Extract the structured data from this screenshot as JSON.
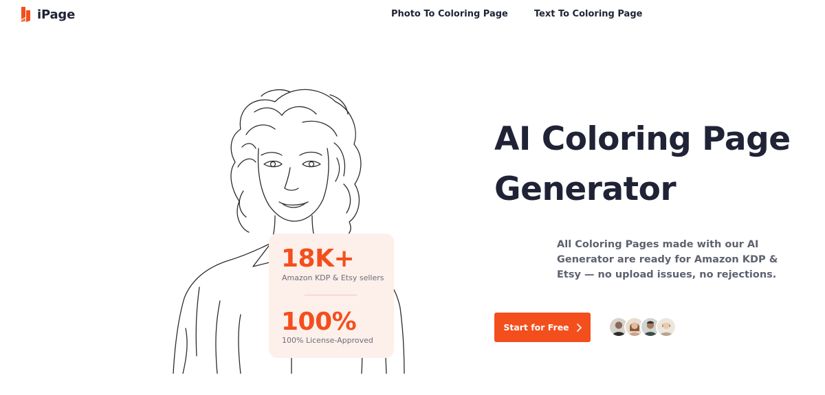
{
  "brand": {
    "name": "iPage",
    "accent_color": "#f34f1d",
    "logo_icon": "bookmark-ribbon-icon"
  },
  "nav": {
    "items": [
      {
        "label": "Photo To Coloring Page"
      },
      {
        "label": "Text To Coloring Page"
      }
    ]
  },
  "hero": {
    "title": "AI Coloring Page Generator",
    "subtitle": "All Coloring Pages made with our AI Generator are ready for Amazon KDP & Etsy — no upload issues, no rejections.",
    "cta_label": "Start for Free",
    "cta_icon": "chevron-right-icon"
  },
  "stats": [
    {
      "value": "18K+",
      "label": "Amazon KDP & Etsy sellers"
    },
    {
      "value": "100%",
      "label": "100% License-Approved"
    }
  ],
  "illustration": {
    "icon": "line-art-portrait-illustration"
  },
  "avatars": {
    "count": 4,
    "icon": "user-avatar-icon"
  }
}
